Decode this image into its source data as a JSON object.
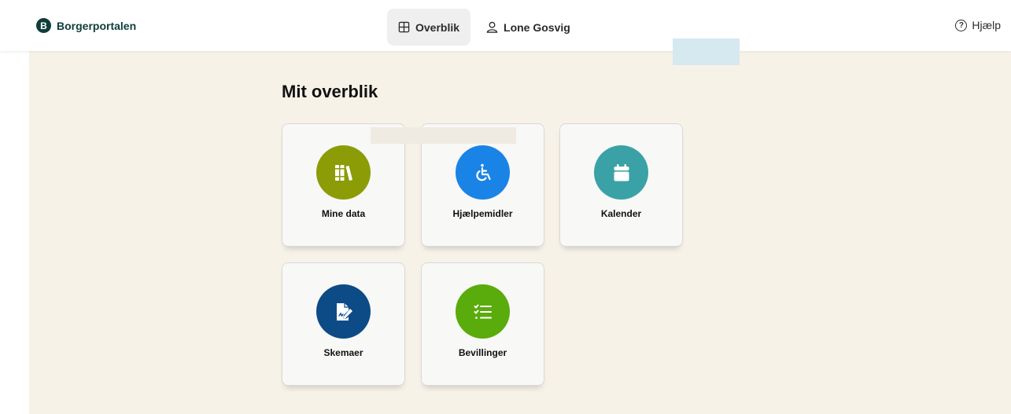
{
  "brand": {
    "logo_letter": "B",
    "name": "Borgerportalen"
  },
  "nav": {
    "overview_label": "Overblik",
    "user_label": "Lone Gosvig"
  },
  "help_label": "Hjælp",
  "page_title": "Mit overblik",
  "tiles": [
    {
      "label": "Mine data",
      "color": "#8b9c07",
      "icon": "books-icon"
    },
    {
      "label": "Hjælpemidler",
      "color": "#1a83e6",
      "icon": "wheelchair-icon"
    },
    {
      "label": "Kalender",
      "color": "#3aa2a6",
      "icon": "calendar-icon"
    },
    {
      "label": "Skemaer",
      "color": "#0d4b86",
      "icon": "form-edit-icon"
    },
    {
      "label": "Bevillinger",
      "color": "#5aab0c",
      "icon": "checklist-icon"
    }
  ]
}
